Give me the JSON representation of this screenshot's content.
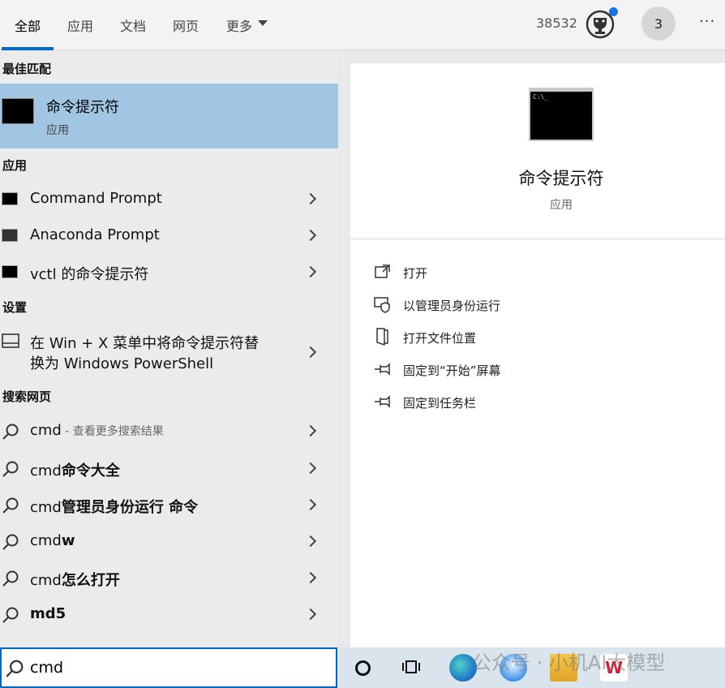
{
  "tabs": [
    {
      "label": "全部"
    },
    {
      "label": "应用"
    },
    {
      "label": "文档"
    },
    {
      "label": "网页"
    },
    {
      "label": "更多"
    }
  ],
  "header": {
    "points": "38532",
    "avatar_text": "3",
    "more": "···"
  },
  "left": {
    "best_match_title": "最佳匹配",
    "best_match": {
      "name": "命令提示符",
      "type": "应用"
    },
    "apps_title": "应用",
    "apps": [
      {
        "label": "Command Prompt"
      },
      {
        "label": "Anaconda Prompt"
      },
      {
        "label": "vctl 的命令提示符"
      }
    ],
    "settings_title": "设置",
    "settings": [
      {
        "line1": "在 Win + X 菜单中将命令提示符替",
        "line2": "换为 Windows PowerShell"
      }
    ],
    "web_title": "搜索网页",
    "web": [
      {
        "prefix": "cmd",
        "rest": "",
        "hint": " - 查看更多搜索结果"
      },
      {
        "prefix": "cmd",
        "rest": "命令大全",
        "hint": ""
      },
      {
        "prefix": "cmd",
        "rest": "管理员身份运行 命令",
        "hint": ""
      },
      {
        "prefix": "cmd",
        "rest": "w",
        "hint": ""
      },
      {
        "prefix": "cmd",
        "rest": "怎么打开",
        "hint": ""
      },
      {
        "prefix": "",
        "rest": "md5",
        "hint": ""
      }
    ]
  },
  "detail": {
    "name": "命令提示符",
    "type": "应用",
    "icon_prompt": "C:\\_",
    "actions": [
      {
        "label": "打开",
        "icon": "open-icon"
      },
      {
        "label": "以管理员身份运行",
        "icon": "admin-shield-icon"
      },
      {
        "label": "打开文件位置",
        "icon": "file-location-icon"
      },
      {
        "label": "固定到“开始”屏幕",
        "icon": "pin-icon"
      },
      {
        "label": "固定到任务栏",
        "icon": "pin-icon"
      }
    ]
  },
  "search": {
    "value": "cmd"
  },
  "watermark": "公众号 · 小机AI大模型",
  "colors": {
    "accent": "#0067c0",
    "selected": "#a1c6e4",
    "badge": "#1a73e8"
  }
}
